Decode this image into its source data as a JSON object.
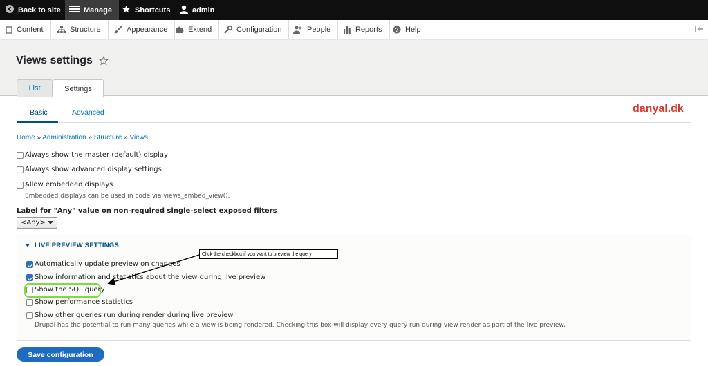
{
  "toolbar": {
    "back_label": "Back to site",
    "manage_label": "Manage",
    "shortcuts_label": "Shortcuts",
    "user_label": "admin"
  },
  "tray": {
    "items": [
      {
        "label": "Content",
        "icon": "file-icon"
      },
      {
        "label": "Structure",
        "icon": "sitemap-icon"
      },
      {
        "label": "Appearance",
        "icon": "brush-icon"
      },
      {
        "label": "Extend",
        "icon": "puzzle-icon"
      },
      {
        "label": "Configuration",
        "icon": "wrench-icon"
      },
      {
        "label": "People",
        "icon": "people-icon"
      },
      {
        "label": "Reports",
        "icon": "bar-chart-icon"
      },
      {
        "label": "Help",
        "icon": "help-icon"
      }
    ]
  },
  "page": {
    "title": "Views settings",
    "tabs": [
      "List",
      "Settings"
    ],
    "subtabs": [
      "Basic",
      "Advanced"
    ],
    "watermark": "danyal.dk"
  },
  "breadcrumb": [
    "Home",
    "Administration",
    "Structure",
    "Views"
  ],
  "breadcrumb_sep": "»",
  "settings": {
    "master_display": {
      "label": "Always show the master (default) display",
      "checked": false
    },
    "advanced_display": {
      "label": "Always show advanced display settings",
      "checked": false
    },
    "embedded": {
      "label": "Allow embedded displays",
      "checked": false,
      "description": "Embedded displays can be used in code via views_embed_view()."
    },
    "any_label": "Label for \"Any\" value on non-required single-select exposed filters",
    "any_value": "<Any>"
  },
  "live_preview": {
    "title": "LIVE PREVIEW SETTINGS",
    "auto_update": {
      "label": "Automatically update preview on changes",
      "checked": true
    },
    "show_info": {
      "label": "Show information and statistics about the view during live preview",
      "checked": true
    },
    "show_sql": {
      "label": "Show the SQL query",
      "checked": false
    },
    "show_perf": {
      "label": "Show performance statistics",
      "checked": false
    },
    "show_other": {
      "label": "Show other queries run during render during live preview",
      "checked": false,
      "description": "Drupal has the potential to run many queries while a view is being rendered. Checking this box will display every query run during view render as part of the live preview."
    }
  },
  "annotation": "Click the checkbox if you want to preview the query",
  "actions": {
    "save_label": "Save configuration"
  },
  "colors": {
    "accent": "#0074bd",
    "button": "#1f6bbf",
    "highlight": "#7fdc3f",
    "watermark": "#d63a2a"
  }
}
